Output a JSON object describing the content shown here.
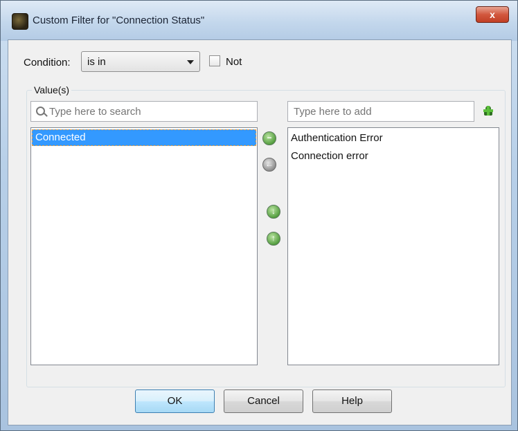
{
  "window": {
    "title": "Custom Filter for \"Connection Status\"",
    "close_label": "x"
  },
  "condition": {
    "label": "Condition:",
    "selected": "is in",
    "not_label": "Not",
    "not_checked": false
  },
  "values": {
    "group_label": "Value(s)",
    "search_placeholder": "Type here to search",
    "add_placeholder": "Type here to add",
    "left_items": [
      "Connected"
    ],
    "right_items": [
      "Authentication Error",
      "Connection error"
    ]
  },
  "buttons": {
    "ok": "OK",
    "cancel": "Cancel",
    "help": "Help"
  },
  "icons": {
    "title": "app-icon",
    "remove": "remove-icon",
    "add_selected": "move-left-icon",
    "move_down": "move-down-icon",
    "move_up": "move-up-icon",
    "add_value": "add-value-icon"
  }
}
